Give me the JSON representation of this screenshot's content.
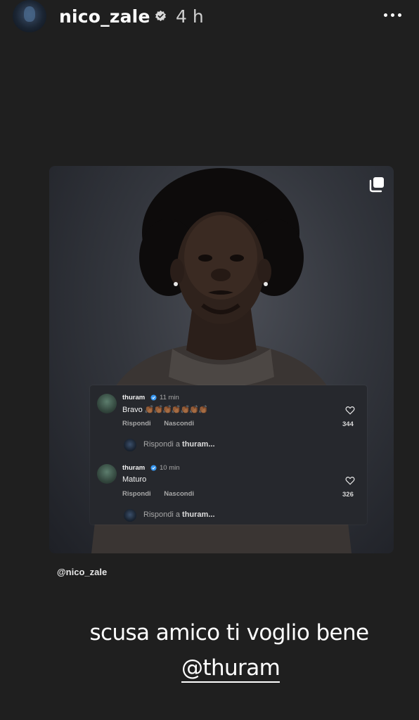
{
  "header": {
    "username": "nico_zale",
    "time": "4 h",
    "avatar_icon": "profile-avatar",
    "verified_icon": "verified-badge-icon",
    "more_icon": "more-options-icon"
  },
  "post": {
    "multi_icon": "carousel-multiple-icon",
    "comments": [
      {
        "user": "thuram",
        "time": "11 min",
        "text": "Bravo",
        "emoji": "👏🏾👏🏾👏🏾👏🏾👏🏾👏🏾👏🏾",
        "reply_label": "Rispondi",
        "hide_label": "Nascondi",
        "likes": "344",
        "reply_prompt_prefix": "Rispondi a",
        "reply_prompt_user": "thuram..."
      },
      {
        "user": "thuram",
        "time": "10 min",
        "text": "Maturo",
        "reply_label": "Rispondi",
        "hide_label": "Nascondi",
        "likes": "326",
        "reply_prompt_prefix": "Rispondi a",
        "reply_prompt_user": "thuram..."
      }
    ]
  },
  "mention_small": "@nico_zale",
  "caption": {
    "text": "scusa amico ti voglio bene",
    "tag": "@thuram"
  },
  "colors": {
    "background": "#1f1f1f",
    "comment_panel": "#26282d",
    "verified": "#3897f0"
  }
}
